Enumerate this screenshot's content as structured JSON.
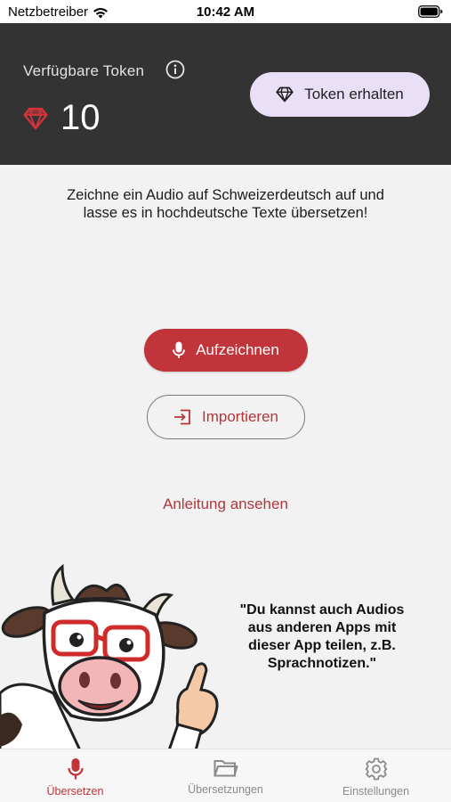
{
  "status_bar": {
    "carrier": "Netzbetreiber",
    "time": "10:42 AM"
  },
  "header": {
    "token_label": "Verfügbare Token",
    "token_count": "10",
    "get_token_label": "Token erhalten"
  },
  "main": {
    "intro_text": "Zeichne ein Audio auf Schweizerdeutsch auf und lasse es in hochdeutsche Texte übersetzen!",
    "record_label": "Aufzeichnen",
    "import_label": "Importieren",
    "guide_label": "Anleitung ansehen",
    "quote": "\"Du kannst auch Audios aus anderen Apps mit dieser App teilen, z.B. Sprachnotizen.\""
  },
  "tabs": [
    {
      "label": "Übersetzen",
      "icon": "microphone-icon",
      "active": true
    },
    {
      "label": "Übersetzungen",
      "icon": "folder-icon",
      "active": false
    },
    {
      "label": "Einstellungen",
      "icon": "gear-icon",
      "active": false
    }
  ],
  "colors": {
    "accent": "#c0343a",
    "header_bg": "#333333",
    "token_button_bg": "#e9e0f7",
    "background": "#f2f2f2",
    "gem": "#d8333b"
  }
}
